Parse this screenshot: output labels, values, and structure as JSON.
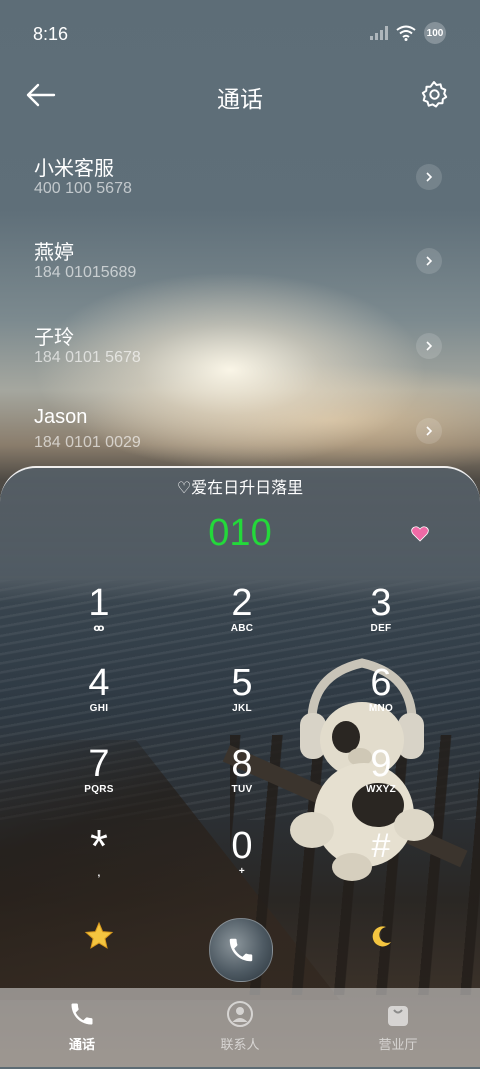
{
  "status_bar": {
    "time": "8:16",
    "battery": "100"
  },
  "header": {
    "title": "通话"
  },
  "contacts": [
    {
      "name": "小米客服",
      "number": "400 100 5678"
    },
    {
      "name": "燕婷",
      "number": "184 01015689"
    },
    {
      "name": "子玲",
      "number": "184 0101 5678"
    },
    {
      "name": "Jason",
      "number": "184 0101 0029"
    }
  ],
  "dialer": {
    "motto": "♡爱在日升日落里",
    "dialed_number": "010",
    "keys": [
      {
        "digit": "1",
        "letters": "ꝏ"
      },
      {
        "digit": "2",
        "letters": "ABC"
      },
      {
        "digit": "3",
        "letters": "DEF"
      },
      {
        "digit": "4",
        "letters": "GHI"
      },
      {
        "digit": "5",
        "letters": "JKL"
      },
      {
        "digit": "6",
        "letters": "MNO"
      },
      {
        "digit": "7",
        "letters": "PQRS"
      },
      {
        "digit": "8",
        "letters": "TUV"
      },
      {
        "digit": "9",
        "letters": "WXYZ"
      },
      {
        "digit": "*",
        "letters": ","
      },
      {
        "digit": "0",
        "letters": "+"
      },
      {
        "digit": "#",
        "letters": ""
      }
    ]
  },
  "bottom_nav": [
    {
      "label": "通话",
      "icon": "phone-icon",
      "active": true
    },
    {
      "label": "联系人",
      "icon": "person-icon",
      "active": false
    },
    {
      "label": "营业厅",
      "icon": "shopping-bag-icon",
      "active": false
    }
  ],
  "colors": {
    "dialed": "#23d93a",
    "accent": "#ffffff"
  }
}
